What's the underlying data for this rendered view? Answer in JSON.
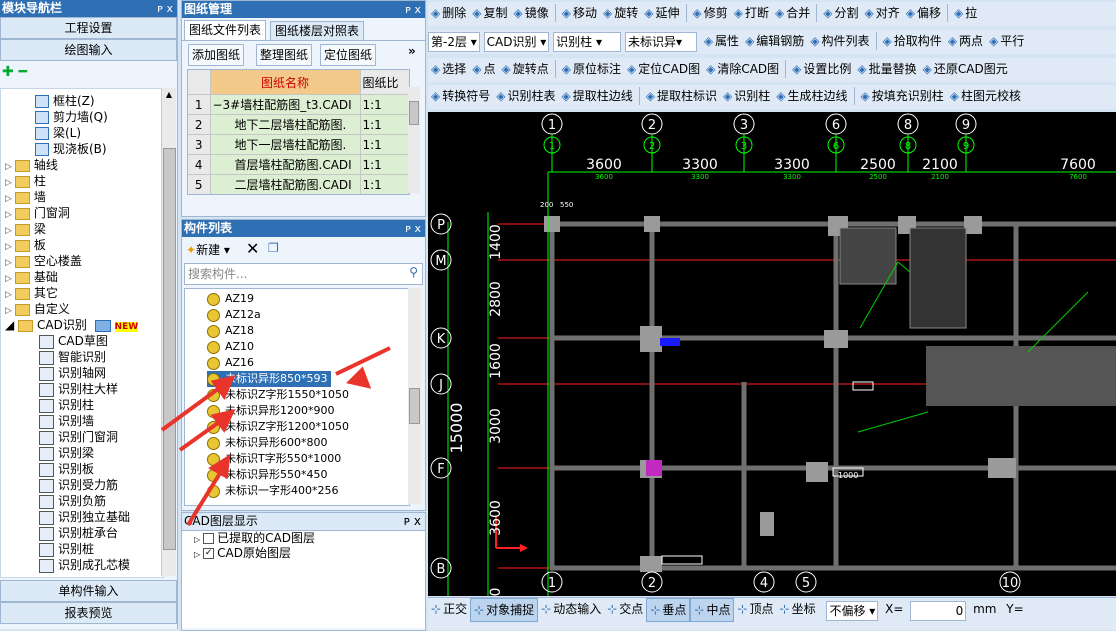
{
  "left_panel": {
    "title": "模块导航栏",
    "pin": "ᴘ x",
    "btn_project": "工程设置",
    "btn_drawing": "绘图输入",
    "collapse_icons": "⁺₊ ⁼",
    "tree_top": [
      {
        "label": "框柱(Z)"
      },
      {
        "label": "剪力墙(Q)"
      },
      {
        "label": "梁(L)"
      },
      {
        "label": "现浇板(B)"
      }
    ],
    "folders": [
      "轴线",
      "柱",
      "墙",
      "门窗洞",
      "梁",
      "板",
      "空心楼盖",
      "基础",
      "其它",
      "自定义"
    ],
    "cad_folder": "CAD识别",
    "new_badge": "NEW",
    "cad_items": [
      "CAD草图",
      "智能识别",
      "识别轴网",
      "识别柱大样",
      "识别柱",
      "识别墙",
      "识别门窗洞",
      "识别梁",
      "识别板",
      "识别受力筋",
      "识别负筋",
      "识别独立基础",
      "识别桩承台",
      "识别桩",
      "识别成孔芯模"
    ],
    "btn_single": "单构件输入",
    "btn_report": "报表预览"
  },
  "drawing_mgmt": {
    "title": "图纸管理",
    "pin": "ᴘ x",
    "tab1": "图纸文件列表",
    "tab2": "图纸楼层对照表",
    "btn_add": "添加图纸",
    "btn_organize": "整理图纸",
    "btn_locate": "定位图纸",
    "more": "»",
    "col_name": "图纸名称",
    "col_ratio": "图纸比",
    "rows": [
      {
        "no": "1",
        "name": "3#墙柱配筋图_t3.CADI",
        "ratio": "1:1",
        "expand": "−"
      },
      {
        "no": "2",
        "name": "地下二层墙柱配筋图.",
        "ratio": "1:1",
        "expand": ""
      },
      {
        "no": "3",
        "name": "地下一层墙柱配筋图.",
        "ratio": "1:1",
        "expand": ""
      },
      {
        "no": "4",
        "name": "首层墙柱配筋图.CADI",
        "ratio": "1:1",
        "expand": ""
      },
      {
        "no": "5",
        "name": "二层墙柱配筋图.CADI",
        "ratio": "1:1",
        "expand": ""
      }
    ]
  },
  "component_list": {
    "title": "构件列表",
    "pin": "ᴘ x",
    "btn_new": "新建",
    "search_placeholder": "搜索构件...",
    "items": [
      {
        "label": "AZ19",
        "selected": false
      },
      {
        "label": "AZ12a",
        "selected": false
      },
      {
        "label": "AZ18",
        "selected": false
      },
      {
        "label": "AZ10",
        "selected": false
      },
      {
        "label": "AZ16",
        "selected": false
      },
      {
        "label": "未标识异形850*593",
        "selected": true
      },
      {
        "label": "未标识Z字形1550*1050",
        "selected": false
      },
      {
        "label": "未标识异形1200*900",
        "selected": false
      },
      {
        "label": "未标识Z字形1200*1050",
        "selected": false
      },
      {
        "label": "未标识异形600*800",
        "selected": false
      },
      {
        "label": "未标识T字形550*1000",
        "selected": false
      },
      {
        "label": "未标识异形550*450",
        "selected": false
      },
      {
        "label": "未标识一字形400*256",
        "selected": false
      }
    ]
  },
  "cad_layers": {
    "title": "CAD图层显示",
    "pin": "ᴘ x",
    "items": [
      {
        "label": "已提取的CAD图层",
        "checked": false
      },
      {
        "label": "CAD原始图层",
        "checked": true
      }
    ]
  },
  "toolbar1": [
    "删除",
    "复制",
    "镜像",
    "移动",
    "旋转",
    "延伸",
    "修剪",
    "打断",
    "合并",
    "分割",
    "对齐",
    "偏移",
    "拉"
  ],
  "toolbar2": {
    "floor": "第-2层",
    "mode": "CAD识别",
    "type": "识别柱",
    "component": "未标识异",
    "buttons": [
      "属性",
      "编辑钢筋",
      "构件列表",
      "拾取构件",
      "两点",
      "平行"
    ]
  },
  "toolbar3": [
    "选择",
    "点",
    "旋转点",
    "原位标注",
    "定位CAD图",
    "清除CAD图",
    "设置比例",
    "批量替换",
    "还原CAD图元"
  ],
  "toolbar4": [
    "转换符号",
    "识别柱表",
    "提取柱边线",
    "提取柱标识",
    "识别柱",
    "生成柱边线",
    "按填充识别柱",
    "柱图元校核"
  ],
  "canvas": {
    "top_axes": [
      "1",
      "2",
      "3",
      "6",
      "8",
      "9"
    ],
    "bottom_axes": [
      "1",
      "2",
      "4",
      "5",
      "10"
    ],
    "left_axes": [
      "P",
      "M",
      "K",
      "J",
      "F",
      "B"
    ],
    "top_dims": [
      "3600",
      "3300",
      "3300",
      "2500",
      "2100",
      "7600"
    ],
    "top_dims_small": [
      "3600",
      "3300",
      "3300",
      "2500",
      "2100",
      "7600"
    ],
    "left_dims": [
      "1400",
      "2800",
      "1600",
      "3000",
      "3600"
    ],
    "total_dim": "15000",
    "dim_small_a": "200",
    "dim_small_b": "550",
    "dim_1000": "1000",
    "dim_zero": "0"
  },
  "statusbar": {
    "buttons": [
      "正交",
      "对象捕捉",
      "动态输入",
      "交点",
      "垂点",
      "中点",
      "顶点",
      "坐标"
    ],
    "offset": "不偏移",
    "x_label": "X=",
    "x_value": "0",
    "unit": "mm",
    "y_label": "Y="
  },
  "colors": {
    "header": "#2f6fb3",
    "accent_selected": "#2f6fb3",
    "canvas_bg": "#000000",
    "axis_green": "#00ff00",
    "grid_red": "#ff2020",
    "arrow_red": "#e8342a"
  }
}
